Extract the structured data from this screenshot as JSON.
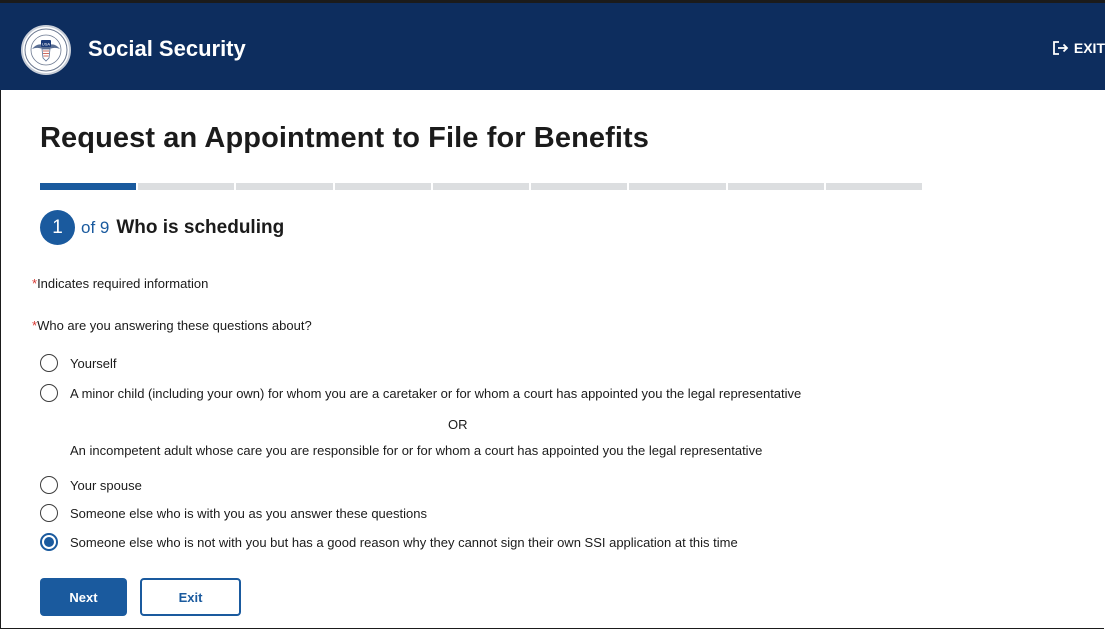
{
  "header": {
    "brand": "Social Security",
    "exit_label": "EXIT",
    "logo_text": "USA"
  },
  "page": {
    "title": "Request an Appointment to File for Benefits"
  },
  "progress": {
    "current_step": 1,
    "total_steps": 9,
    "step_number": "1",
    "of_text": "of 9",
    "step_title": "Who is scheduling"
  },
  "form": {
    "required_star": "*",
    "required_note": "Indicates required information",
    "question": "Who are you answering these questions about?",
    "options": [
      {
        "label": "Yourself",
        "selected": false
      },
      {
        "label": "A minor child (including your own) for whom you are a caretaker or for whom a court has appointed you the legal representative",
        "selected": false
      },
      {
        "label": "Your spouse",
        "selected": false
      },
      {
        "label": "Someone else who is with you as you answer these questions",
        "selected": false
      },
      {
        "label": "Someone else who is not with you but has a good reason why they cannot sign their own SSI application at this time",
        "selected": true
      }
    ],
    "or_text": "OR",
    "alt_text": "An incompetent adult whose care you are responsible for or for whom a court has appointed you the legal representative"
  },
  "buttons": {
    "next": "Next",
    "exit": "Exit"
  },
  "colors": {
    "header_bg": "#0d2d5e",
    "accent": "#1a5a9e",
    "required": "#d83933",
    "progress_track": "#dcdee0"
  }
}
